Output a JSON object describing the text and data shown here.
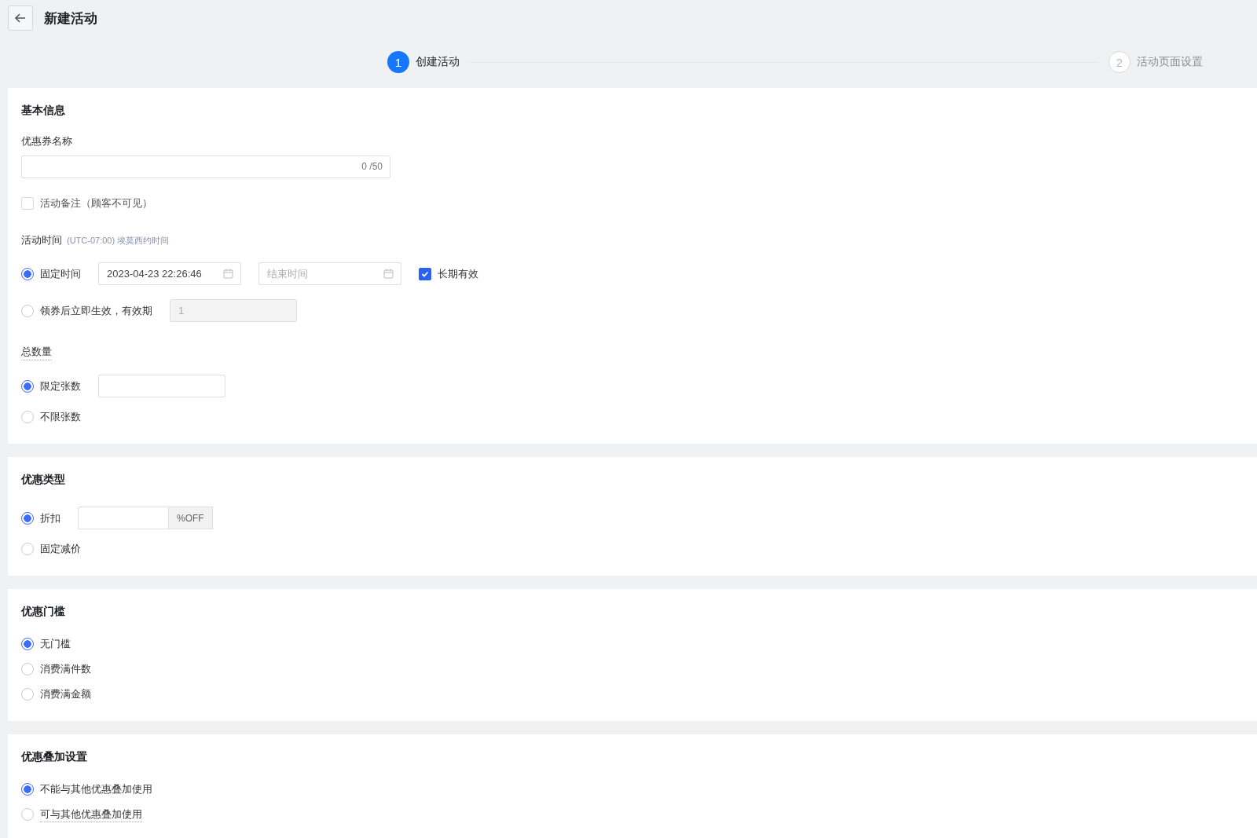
{
  "header": {
    "title": "新建活动"
  },
  "steps": [
    {
      "number": "1",
      "label": "创建活动",
      "selected": true
    },
    {
      "number": "2",
      "label": "活动页面设置",
      "selected": false
    }
  ],
  "sections": [
    {
      "title": "基本信息",
      "fields": [
        {
          "kind": "text-input",
          "label": "优惠券名称",
          "counter": "0 /50"
        },
        {
          "kind": "checkbox",
          "label": "活动备注（顾客不可见）",
          "checked": false
        },
        {
          "kind": "radio-group",
          "label": "活动时间",
          "hint": "(UTC-07:00) 埃莫西约时间",
          "options": [
            {
              "label": "固定时间",
              "selected": true,
              "controls": [
                {
                  "kind": "date",
                  "value": "2023-04-23 22:26:46"
                },
                {
                  "kind": "date",
                  "placeholder": "结束时间"
                },
                {
                  "kind": "checkbox",
                  "label": "长期有效",
                  "checked": true
                }
              ]
            },
            {
              "label": "领券后立即生效，有效期",
              "selected": false,
              "controls": [
                {
                  "kind": "input",
                  "placeholder": "1",
                  "disabled": true
                }
              ]
            }
          ]
        },
        {
          "kind": "radio-group",
          "label": "总数量",
          "tooltip": true,
          "options": [
            {
              "label": "限定张数",
              "selected": true,
              "controls": [
                {
                  "kind": "input",
                  "disabled": false
                }
              ]
            },
            {
              "label": "不限张数",
              "selected": false
            }
          ]
        }
      ]
    },
    {
      "title": "优惠类型",
      "fields": [
        {
          "kind": "radio-group",
          "options": [
            {
              "label": "折扣",
              "selected": true,
              "controls": [
                {
                  "kind": "suffix-input",
                  "suffix": "%OFF"
                }
              ]
            },
            {
              "label": "固定减价",
              "selected": false
            }
          ]
        }
      ]
    },
    {
      "title": "优惠门槛",
      "fields": [
        {
          "kind": "radio-group",
          "options": [
            {
              "label": "无门槛",
              "selected": true
            },
            {
              "label": "消费满件数",
              "selected": false
            },
            {
              "label": "消费满金额",
              "selected": false
            }
          ]
        }
      ]
    },
    {
      "title": "优惠叠加设置",
      "fields": [
        {
          "kind": "radio-group",
          "options": [
            {
              "label": "不能与其他优惠叠加使用",
              "selected": true
            },
            {
              "label": "可与其他优惠叠加使用",
              "selected": false,
              "tooltip": true
            }
          ]
        }
      ]
    }
  ]
}
